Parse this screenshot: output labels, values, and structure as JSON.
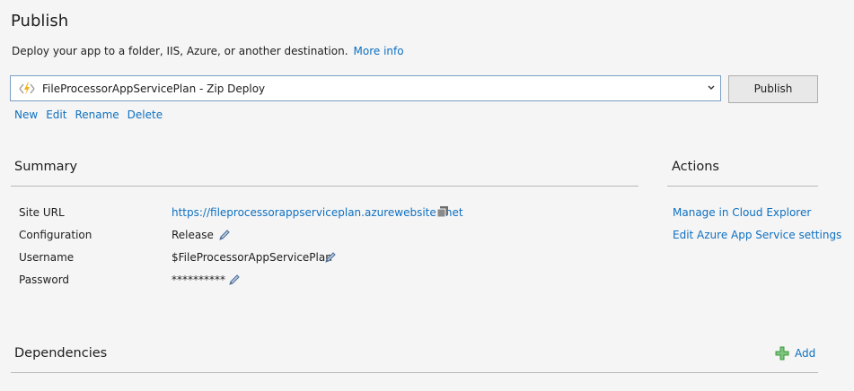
{
  "header": {
    "title": "Publish",
    "subtitle": "Deploy your app to a folder, IIS, Azure, or another destination.",
    "more_info": "More info"
  },
  "profile": {
    "selected": "FileProcessorAppServicePlan - Zip Deploy",
    "icon": "azure-bolt-icon",
    "publish_label": "Publish",
    "actions": [
      "New",
      "Edit",
      "Rename",
      "Delete"
    ]
  },
  "summary": {
    "heading": "Summary",
    "rows": [
      {
        "label": "Site URL",
        "value": "https://fileprocessorappserviceplan.azurewebsites.net"
      },
      {
        "label": "Configuration",
        "value": "Release"
      },
      {
        "label": "Username",
        "value": "$FileProcessorAppServicePlan"
      },
      {
        "label": "Password",
        "value": "**********"
      }
    ]
  },
  "actions": {
    "heading": "Actions",
    "items": [
      "Manage in Cloud Explorer",
      "Edit Azure App Service settings"
    ]
  },
  "dependencies": {
    "heading": "Dependencies",
    "add_label": "Add"
  },
  "colors": {
    "link": "#0e70c0",
    "background": "#f5f5f5",
    "accent_border": "#7a9ec3",
    "add_icon": "#3c9a3c"
  }
}
